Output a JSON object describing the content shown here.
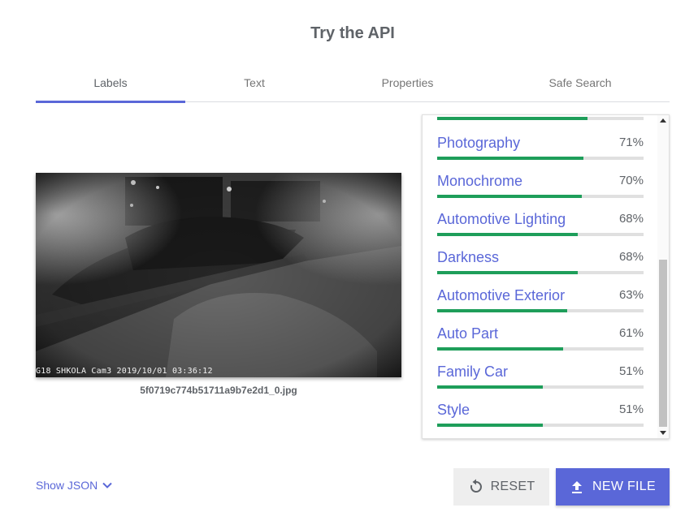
{
  "header": {
    "title": "Try the API"
  },
  "tabs": [
    {
      "label": "Labels",
      "active": true
    },
    {
      "label": "Text",
      "active": false
    },
    {
      "label": "Properties",
      "active": false
    },
    {
      "label": "Safe Search",
      "active": false
    }
  ],
  "image": {
    "overlay_text": "G18 SHKOLA Cam3 2019/10/01 03:36:12",
    "filename": "5f0719c774b51711a9b7e2d1_0.jpg"
  },
  "results": [
    {
      "label": "Photography",
      "percent": "71%",
      "score": 0.71
    },
    {
      "label": "Monochrome",
      "percent": "70%",
      "score": 0.7
    },
    {
      "label": "Automotive Lighting",
      "percent": "68%",
      "score": 0.68
    },
    {
      "label": "Darkness",
      "percent": "68%",
      "score": 0.68
    },
    {
      "label": "Automotive Exterior",
      "percent": "63%",
      "score": 0.63
    },
    {
      "label": "Auto Part",
      "percent": "61%",
      "score": 0.61
    },
    {
      "label": "Family Car",
      "percent": "51%",
      "score": 0.51
    },
    {
      "label": "Style",
      "percent": "51%",
      "score": 0.51
    }
  ],
  "partial_top_score": 0.73,
  "footer": {
    "show_json_label": "Show JSON",
    "reset_label": "RESET",
    "new_file_label": "NEW FILE"
  },
  "colors": {
    "accent": "#5a67d8",
    "bar_fill": "#1e9e5a",
    "bar_track": "#e0e0e0"
  }
}
